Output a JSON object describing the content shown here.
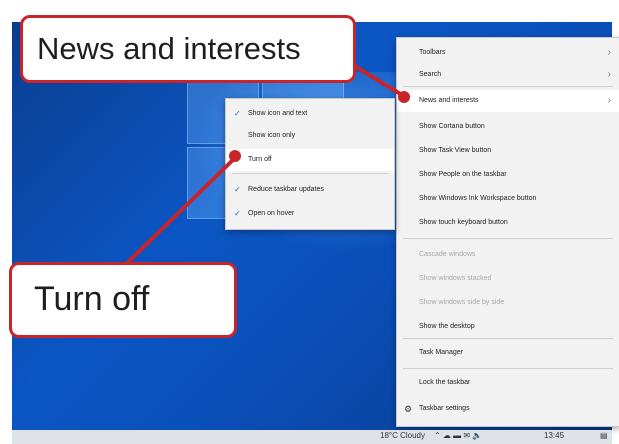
{
  "callouts": {
    "top": "News and interests",
    "bottom": "Turn off"
  },
  "main_menu": {
    "items": [
      {
        "label": "Toolbars",
        "arrow": true
      },
      {
        "label": "Search",
        "arrow": true
      },
      {
        "label": "News and interests",
        "arrow": true,
        "highlight": true
      },
      {
        "label": "Show Cortana button"
      },
      {
        "label": "Show Task View button"
      },
      {
        "label": "Show People on the taskbar"
      },
      {
        "label": "Show Windows Ink Workspace button"
      },
      {
        "label": "Show touch keyboard button"
      },
      {
        "label": "Cascade windows",
        "disabled": true
      },
      {
        "label": "Show windows stacked",
        "disabled": true
      },
      {
        "label": "Show windows side by side",
        "disabled": true
      },
      {
        "label": "Show the desktop"
      },
      {
        "label": "Task Manager"
      },
      {
        "label": "Lock the taskbar"
      },
      {
        "label": "Taskbar settings",
        "icon": "gear-icon"
      }
    ]
  },
  "sub_menu": {
    "items": [
      {
        "label": "Show icon and text",
        "checked": true
      },
      {
        "label": "Show icon only"
      },
      {
        "label": "Turn off",
        "highlight": true
      },
      {
        "label": "Reduce taskbar updates",
        "checked": true
      },
      {
        "label": "Open on hover",
        "checked": true
      }
    ]
  },
  "taskbar": {
    "weather": "18°C Cloudy",
    "time": "13:45"
  },
  "colors": {
    "accent": "#c8242a",
    "desktop": "#0b56c4",
    "check": "#1a6ad6"
  }
}
